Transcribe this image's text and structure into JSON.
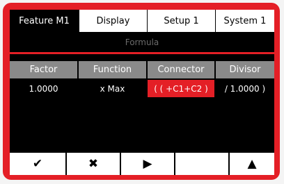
{
  "tabs": [
    {
      "label": "Feature  M1",
      "active": true
    },
    {
      "label": "Display",
      "active": false
    },
    {
      "label": "Setup 1",
      "active": false
    },
    {
      "label": "System 1",
      "active": false
    }
  ],
  "subtitle": "Formula",
  "table": {
    "headers": [
      "Factor",
      "Function",
      "Connector",
      "Divisor"
    ],
    "row": [
      "1.0000",
      "x Max",
      "( ( +C1+C2 )",
      "/ 1.0000 )"
    ],
    "selected_column": 2
  },
  "softkeys": [
    {
      "icon": "check-icon",
      "glyph": "✔"
    },
    {
      "icon": "cross-icon",
      "glyph": "✖"
    },
    {
      "icon": "play-icon",
      "glyph": "▶"
    },
    {
      "icon": "",
      "glyph": ""
    },
    {
      "icon": "up-triangle-icon",
      "glyph": "▲"
    }
  ],
  "colors": {
    "accent": "#e41f26",
    "header_gray": "#8a8a8a"
  }
}
